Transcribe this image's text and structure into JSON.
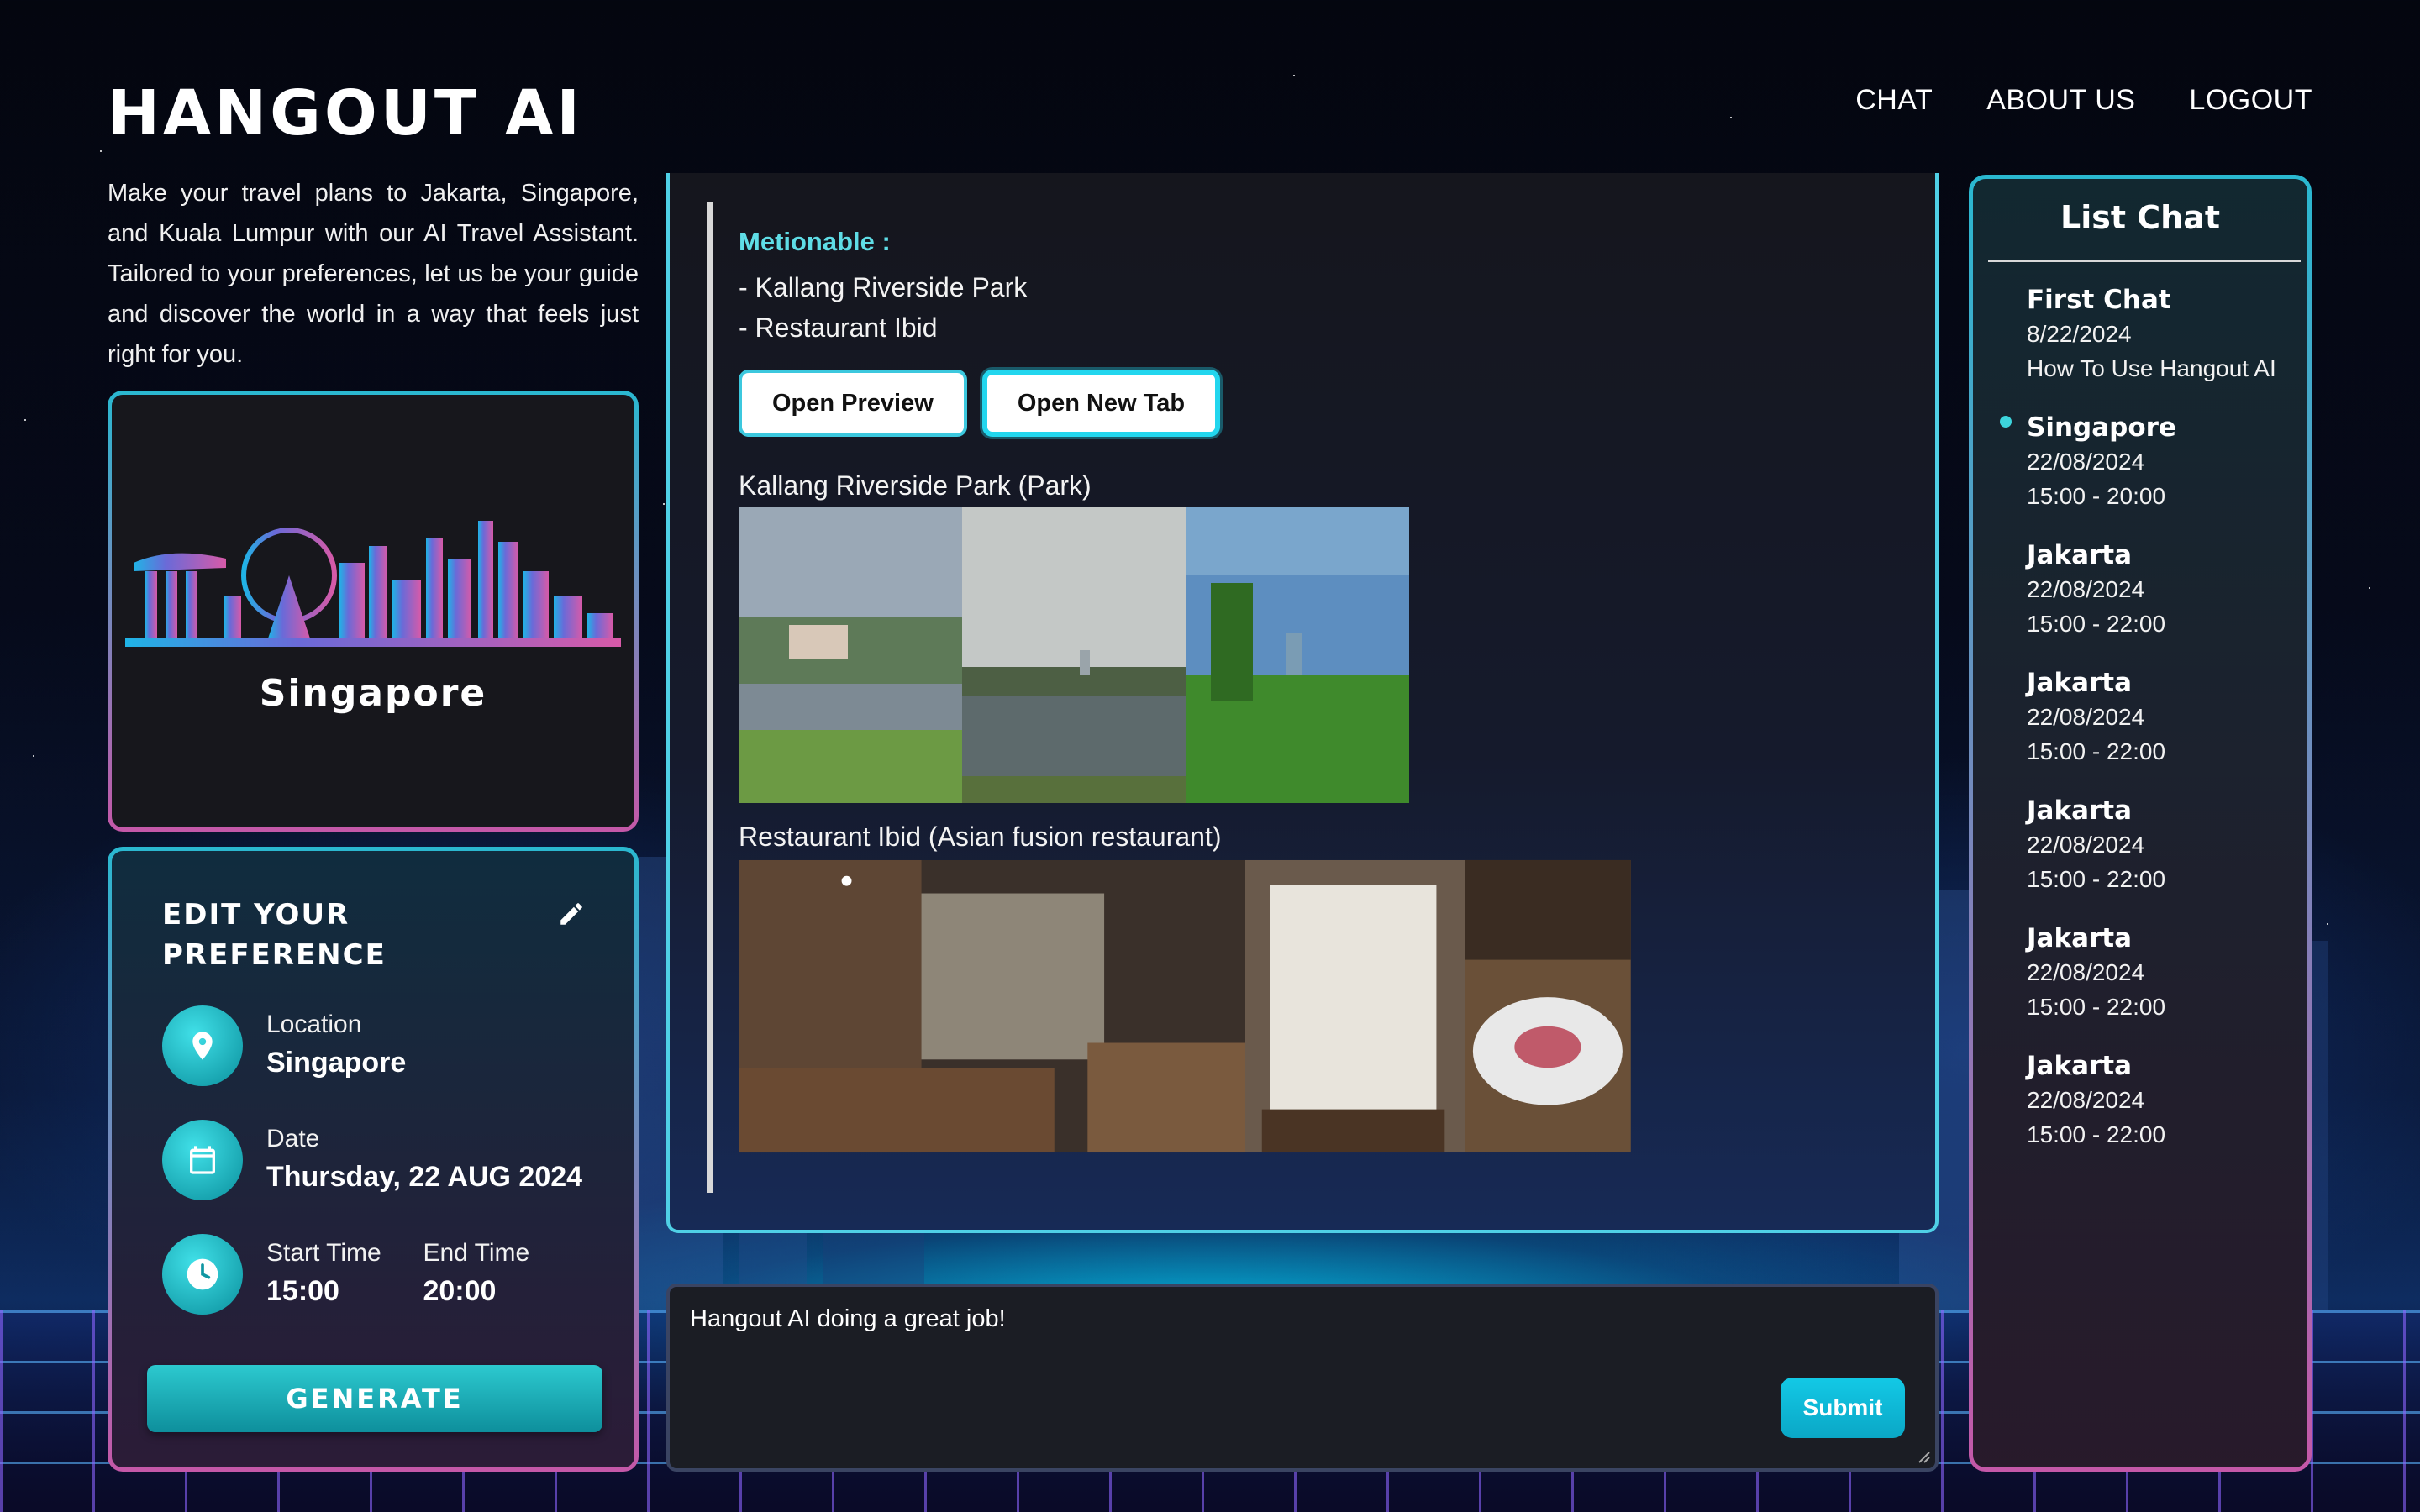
{
  "header": {
    "logo": "HANGOUT AI",
    "nav": [
      "CHAT",
      "ABOUT US",
      "LOGOUT"
    ]
  },
  "intro": "Make your travel plans to Jakarta, Singapore, and Kuala Lumpur with our AI Travel Assistant. Tailored to your preferences, let us be your guide and discover the world in a way that feels just right for you.",
  "city_card": {
    "name": "Singapore"
  },
  "preference": {
    "title": "EDIT YOUR PREFERENCE",
    "location_label": "Location",
    "location_value": "Singapore",
    "date_label": "Date",
    "date_value": "Thursday, 22 AUG 2024",
    "start_label": "Start Time",
    "start_value": "15:00",
    "end_label": "End Time",
    "end_value": "20:00",
    "generate_label": "GENERATE"
  },
  "message": {
    "heading": "Metionable :",
    "items": [
      "- Kallang Riverside Park",
      "- Restaurant Ibid"
    ],
    "preview_label": "Open Preview",
    "newtab_label": "Open New Tab",
    "places": [
      {
        "title": "Kallang Riverside Park (Park)"
      },
      {
        "title": "Restaurant Ibid (Asian fusion restaurant)"
      }
    ]
  },
  "input": {
    "value": "Hangout AI doing a great job!",
    "submit_label": "Submit"
  },
  "list_chat": {
    "title": "List Chat",
    "items": [
      {
        "title": "First Chat",
        "line1": "8/22/2024",
        "line2": "How To Use Hangout AI",
        "active": false
      },
      {
        "title": "Singapore",
        "line1": "22/08/2024",
        "line2": "15:00 - 20:00",
        "active": true
      },
      {
        "title": "Jakarta",
        "line1": "22/08/2024",
        "line2": "15:00 - 22:00",
        "active": false
      },
      {
        "title": "Jakarta",
        "line1": "22/08/2024",
        "line2": "15:00 - 22:00",
        "active": false
      },
      {
        "title": "Jakarta",
        "line1": "22/08/2024",
        "line2": "15:00 - 22:00",
        "active": false
      },
      {
        "title": "Jakarta",
        "line1": "22/08/2024",
        "line2": "15:00 - 22:00",
        "active": false
      },
      {
        "title": "Jakarta",
        "line1": "22/08/2024",
        "line2": "15:00 - 22:00",
        "active": false
      }
    ]
  },
  "colors": {
    "accent": "#2cc9cf",
    "mention": "#5fdde6",
    "border_top": "#2ab8d0",
    "border_bottom": "#c458a8"
  }
}
